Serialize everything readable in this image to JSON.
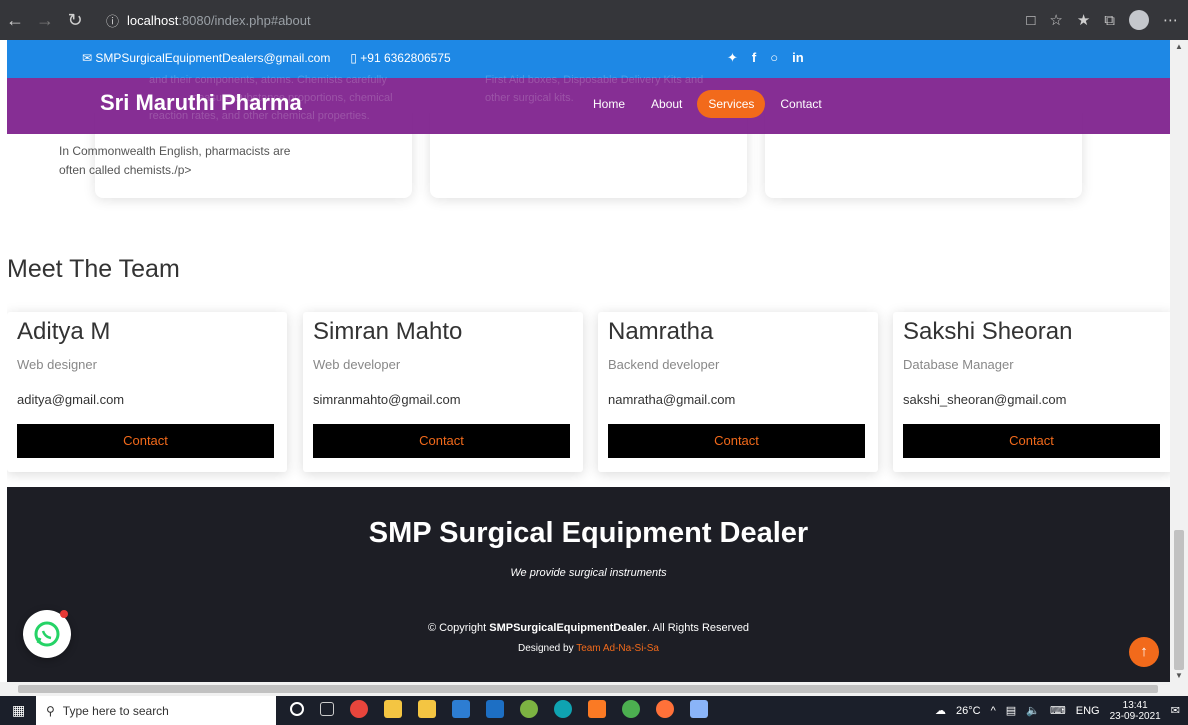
{
  "browser": {
    "url_host": "localhost",
    "url_path": ":8080/index.php#about"
  },
  "topbar": {
    "email": "SMPSurgicalEquipmentDealers@gmail.com",
    "phone": "+91 6362806575",
    "social_icons": [
      "twitter-icon",
      "facebook-icon",
      "instagram-icon",
      "linkedin-icon"
    ]
  },
  "header": {
    "logo": "Sri Maruthi Pharma",
    "nav": [
      "Home",
      "About",
      "Services",
      "Contact"
    ],
    "active": "Services"
  },
  "ghost_text": {
    "left1": "and their components, atoms. Chemists carefully",
    "left2": "measure substance proportions, chemical",
    "left3": "reaction rates, and other chemical properties.",
    "middle1": "First Aid boxes, Disposable Delivery Kits and",
    "middle2": "other surgical kits."
  },
  "services": {
    "card1_line1": "In Commonwealth English, pharmacists are",
    "card1_line2": "often called chemists./p>"
  },
  "team": {
    "title": "Meet The Team",
    "members": [
      {
        "name": "Aditya M",
        "role": "Web designer",
        "email": "aditya@gmail.com",
        "button": "Contact"
      },
      {
        "name": "Simran Mahto",
        "role": "Web developer",
        "email": "simranmahto@gmail.com",
        "button": "Contact"
      },
      {
        "name": "Namratha",
        "role": "Backend developer",
        "email": "namratha@gmail.com",
        "button": "Contact"
      },
      {
        "name": "Sakshi Sheoran",
        "role": "Database Manager",
        "email": "sakshi_sheoran@gmail.com",
        "button": "Contact"
      }
    ]
  },
  "footer": {
    "brand": "SMP Surgical Equipment Dealer",
    "tagline": "We provide surgical instruments",
    "copyright_prefix": "© Copyright ",
    "copyright_name": "SMPSurgicalEquipmentDealer",
    "copyright_suffix": ". All Rights Reserved",
    "designed_prefix": "Designed by ",
    "designed_team": "Team Ad-Na-Si-Sa"
  },
  "taskbar": {
    "search_placeholder": "Type here to search",
    "weather": "26°C",
    "lang": "ENG",
    "time": "13:41",
    "date": "23-09-2021"
  },
  "colors": {
    "topbar": "#1e88e5",
    "header": "#7d1e8c",
    "accent": "#f26a1b",
    "footer": "#1d1e25"
  }
}
